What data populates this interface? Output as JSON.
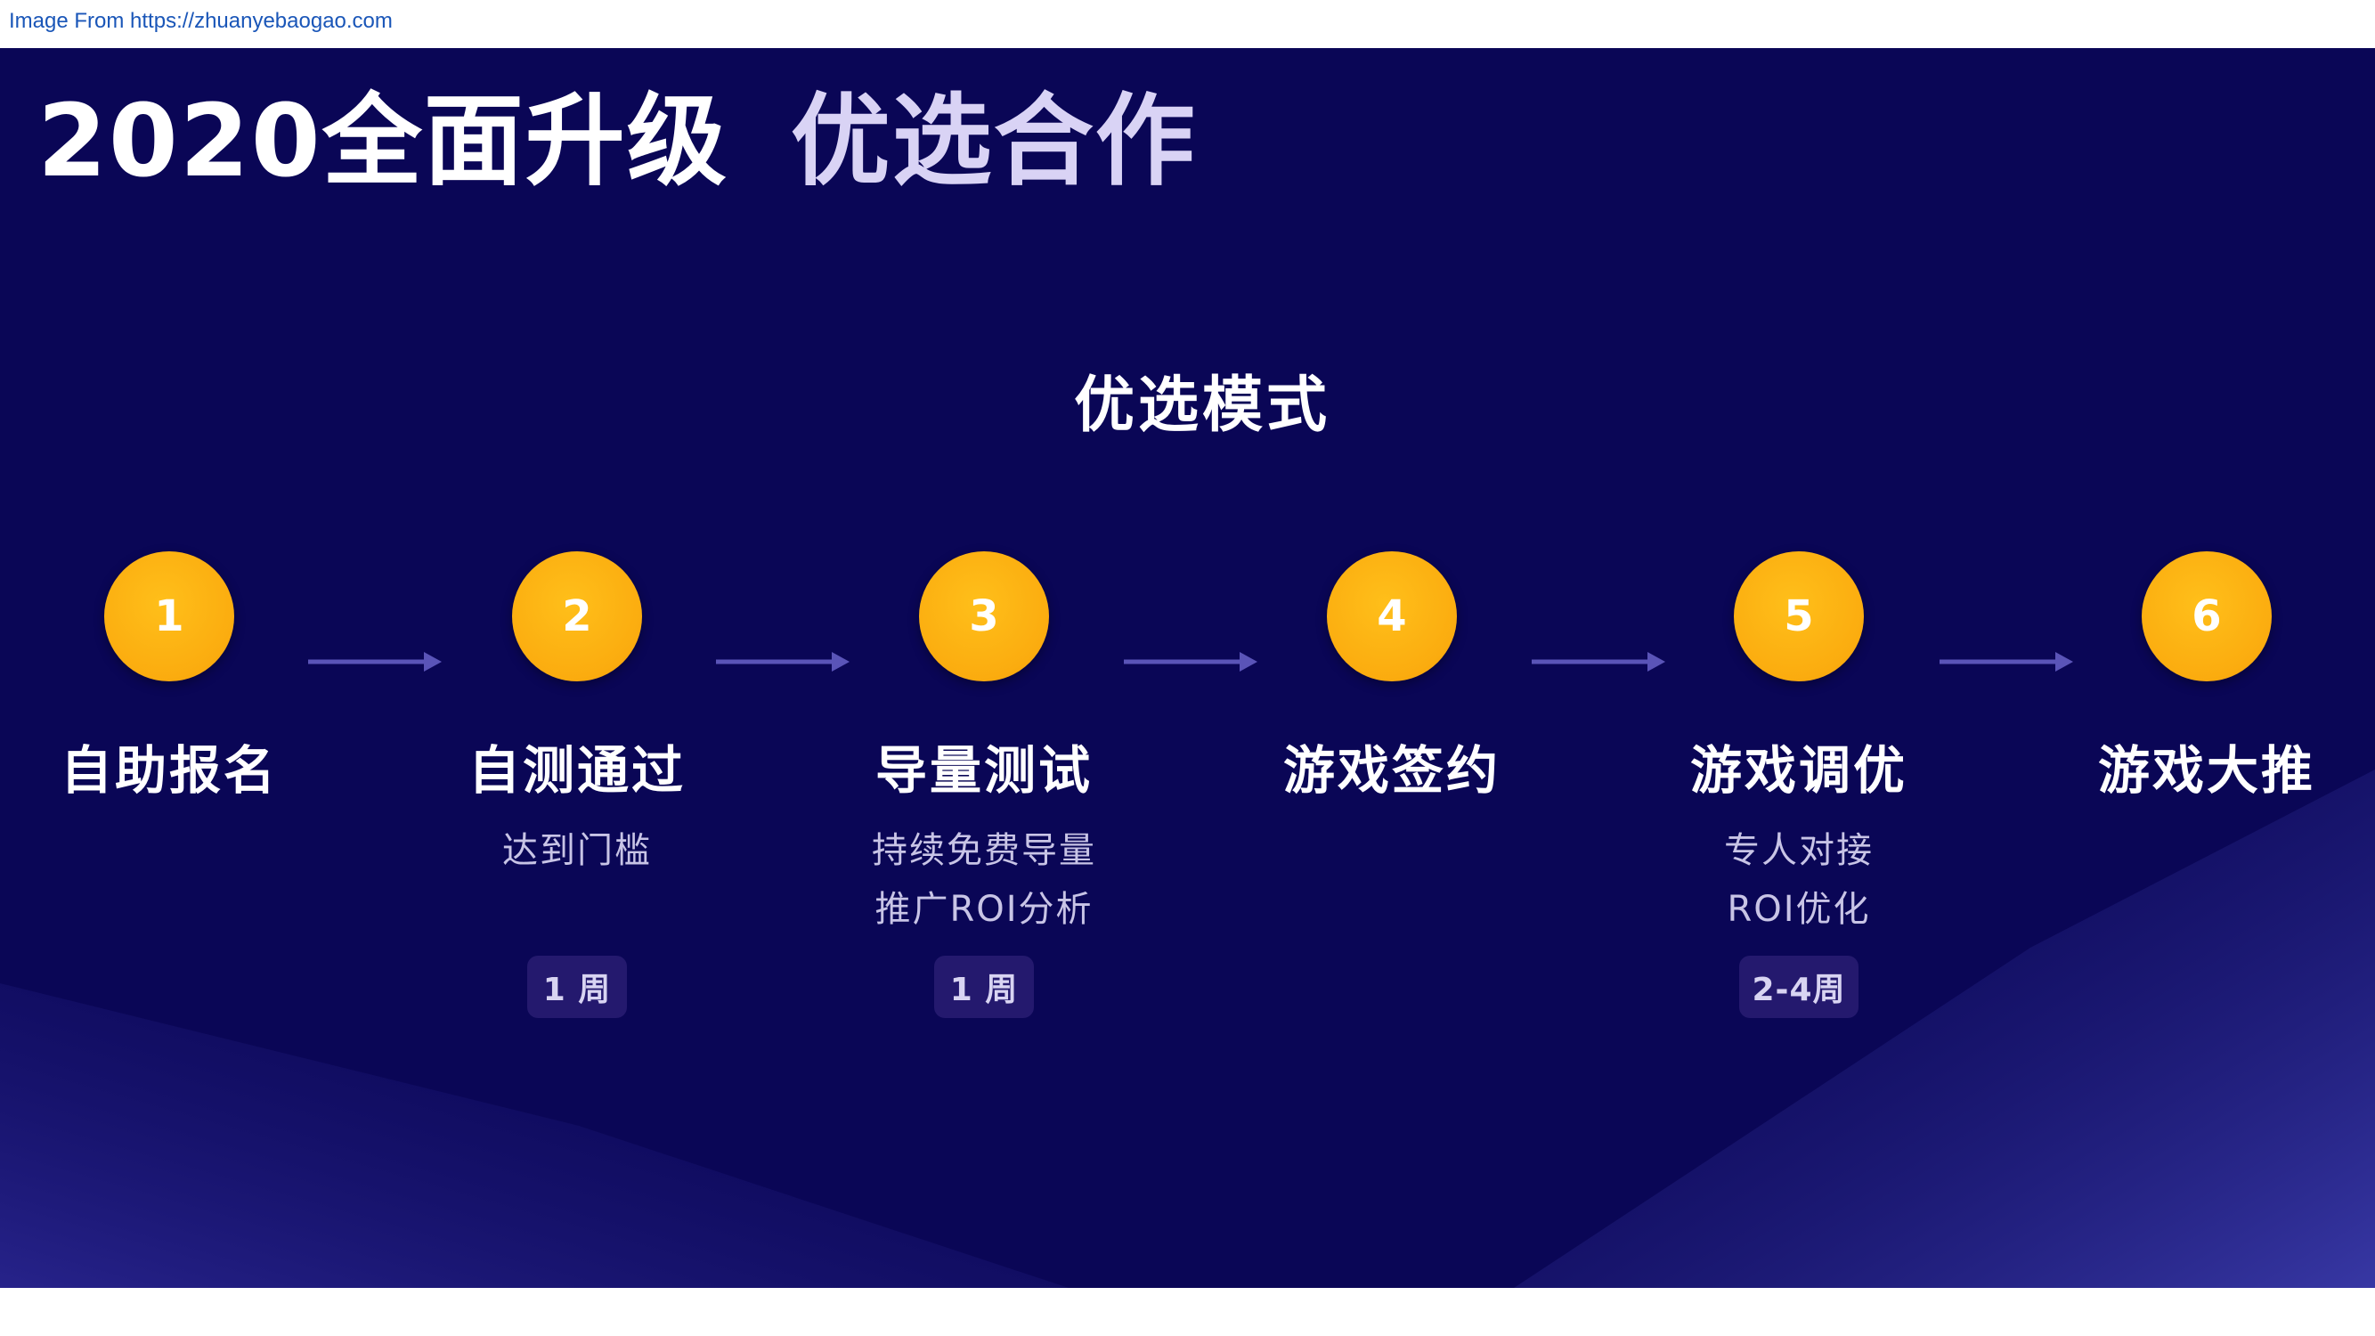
{
  "source": {
    "text": "Image From https://zhuanyebaogao.com"
  },
  "slide": {
    "title_main": "2020全面升级",
    "title_sub": "优选合作",
    "section_title": "优选模式"
  },
  "colors": {
    "background": "#0a0656",
    "circle": "#fbac0f",
    "arrow": "#5a54b8",
    "badge": "#24196e"
  },
  "steps": [
    {
      "number": "1",
      "label": "自助报名",
      "desc_1": "",
      "desc_2": "",
      "duration": ""
    },
    {
      "number": "2",
      "label": "自测通过",
      "desc_1": "达到门槛",
      "desc_2": "",
      "duration": "1 周"
    },
    {
      "number": "3",
      "label": "导量测试",
      "desc_1": "持续免费导量",
      "desc_2": "推广ROI分析",
      "duration": "1 周"
    },
    {
      "number": "4",
      "label": "游戏签约",
      "desc_1": "",
      "desc_2": "",
      "duration": ""
    },
    {
      "number": "5",
      "label": "游戏调优",
      "desc_1": "专人对接",
      "desc_2": "ROI优化",
      "duration": "2-4周"
    },
    {
      "number": "6",
      "label": "游戏大推",
      "desc_1": "",
      "desc_2": "",
      "duration": ""
    }
  ]
}
